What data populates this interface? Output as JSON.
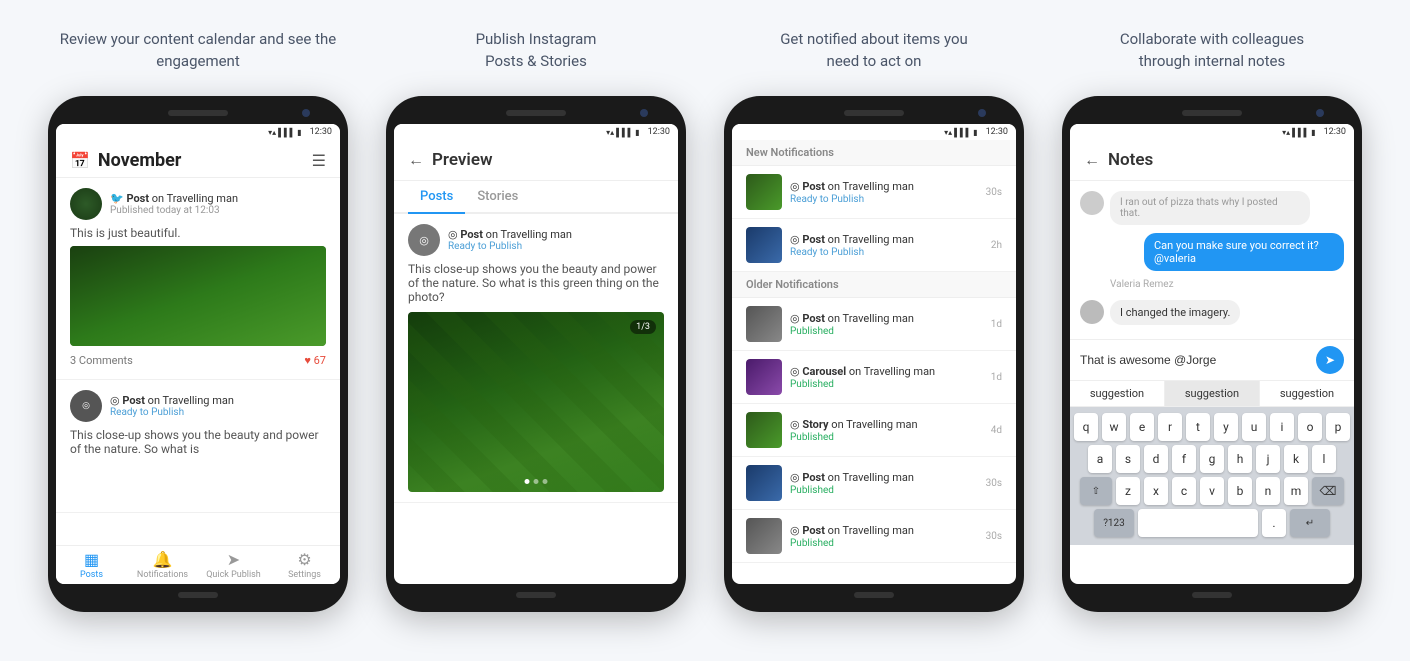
{
  "screens": [
    {
      "id": "calendar",
      "caption": "Review your content calendar\nand see the engagement",
      "header": {
        "title": "November",
        "filter_label": "≡"
      },
      "posts": [
        {
          "id": "post1",
          "type_prefix": "Post on",
          "channel": "Travelling man",
          "status": "Published today at 12:03",
          "status_type": "published",
          "description": "This is just beautiful.",
          "has_image": true,
          "has_video": true,
          "comments": "3 Comments",
          "likes": "67"
        },
        {
          "id": "post2",
          "type_prefix": "Post on",
          "channel": "Travelling man",
          "status": "Ready to Publish",
          "status_type": "ready",
          "description": "This close-up shows you the beauty and power of the nature. So what is",
          "has_image": false
        }
      ],
      "nav": [
        {
          "icon": "▦",
          "label": "Posts",
          "active": true
        },
        {
          "icon": "🔔",
          "label": "Notifications",
          "active": false
        },
        {
          "icon": "➤",
          "label": "Quick Publish",
          "active": false
        },
        {
          "icon": "⚙",
          "label": "Settings",
          "active": false
        }
      ]
    },
    {
      "id": "preview",
      "caption": "Publish Instagram\nPosts & Stories",
      "header_back": "←",
      "header_title": "Preview",
      "tabs": [
        {
          "label": "Posts",
          "active": true
        },
        {
          "label": "Stories",
          "active": false
        }
      ],
      "post": {
        "type_prefix": "Post on",
        "channel": "Travelling man",
        "status": "Ready to Publish",
        "status_type": "ready",
        "description": "This close-up shows you the beauty and power of the nature. So what is this green thing on the photo?",
        "carousel_badge": "1/3"
      }
    },
    {
      "id": "notifications",
      "caption": "Get notified about items you\nneed to act on",
      "sections": [
        {
          "title": "New Notifications",
          "items": [
            {
              "type_prefix": "Post on",
              "channel": "Travelling man",
              "status": "Ready to Publish",
              "status_type": "ready",
              "time": "30s",
              "thumb": "green"
            },
            {
              "type_prefix": "Post on",
              "channel": "Travelling man",
              "status": "Ready to Publish",
              "status_type": "ready",
              "time": "2h",
              "thumb": "blue"
            }
          ]
        },
        {
          "title": "Older Notifications",
          "items": [
            {
              "type_prefix": "Post on",
              "channel": "Travelling man",
              "status": "Published",
              "status_type": "published",
              "time": "1d",
              "thumb": "gray"
            },
            {
              "type_prefix": "Carousel on",
              "channel": "Travelling man",
              "type_bold": "Carousel",
              "status": "Published",
              "status_type": "published",
              "time": "1d",
              "thumb": "purple"
            },
            {
              "type_prefix": "Story on",
              "channel": "Travelling man",
              "type_bold": "Story",
              "status": "Published",
              "status_type": "published",
              "time": "4d",
              "thumb": "green"
            },
            {
              "type_prefix": "Post on",
              "channel": "Travelling man",
              "status": "Published",
              "status_type": "published",
              "time": "30s",
              "thumb": "blue"
            },
            {
              "type_prefix": "Post on",
              "channel": "Travelling man",
              "status": "Published",
              "status_type": "published",
              "time": "30s",
              "thumb": "gray"
            }
          ]
        }
      ]
    },
    {
      "id": "notes",
      "caption": "Collaborate with colleagues\nthrough internal notes",
      "header_back": "←",
      "header_title": "Notes",
      "messages": [
        {
          "sender": "other",
          "text": "I ran out of pizza thats why I posted that.",
          "bubble_type": "gray"
        },
        {
          "sender": "me",
          "text": "Can you make sure you correct it? @valeria",
          "bubble_type": "blue"
        },
        {
          "sender": "name_only",
          "name": "Valeria Remez"
        },
        {
          "sender": "other",
          "text": "I changed the imagery.",
          "bubble_type": "gray"
        }
      ],
      "input_value": "That is awesome @Jorge",
      "suggestions": [
        "suggestion",
        "suggestion",
        "suggestion"
      ],
      "keyboard_rows": [
        [
          "q",
          "w",
          "e",
          "r",
          "t",
          "y",
          "u",
          "i",
          "o",
          "p"
        ],
        [
          "a",
          "s",
          "d",
          "f",
          "g",
          "h",
          "j",
          "k",
          "l"
        ],
        [
          "⇧",
          "z",
          "x",
          "c",
          "v",
          "b",
          "n",
          "m",
          "⌫"
        ],
        [
          "?123",
          "",
          ".",
          "↵"
        ]
      ]
    }
  ]
}
